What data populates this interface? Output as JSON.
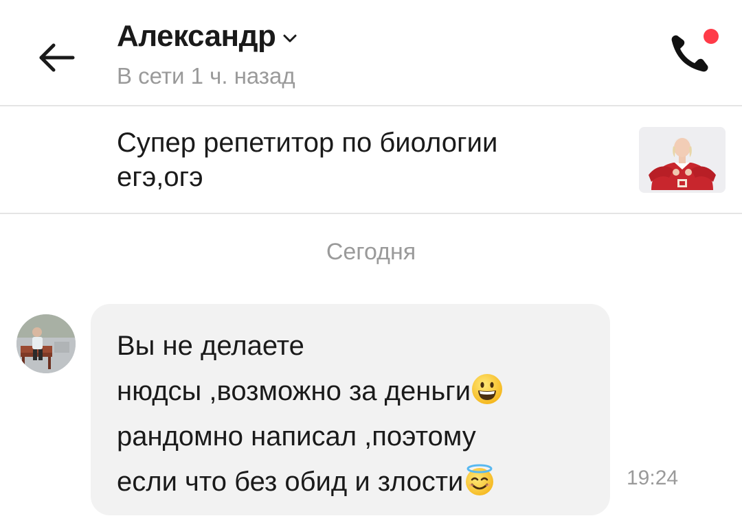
{
  "header": {
    "contact_name": "Александр",
    "status": "В сети 1 ч. назад",
    "icons": {
      "back": "arrow-left-icon",
      "dropdown": "chevron-down-icon",
      "call": "phone-icon"
    },
    "notification_color": "#ff3b48"
  },
  "listing": {
    "title_line1": "Супер репетитор по биологии",
    "title_line2": "егэ,огэ",
    "thumbnail": "listing-photo"
  },
  "chat": {
    "date_separator": "Сегодня",
    "messages": [
      {
        "sender": "Александр",
        "lines": [
          "Вы не делаете",
          "нюдсы ,возможно за деньги",
          "рандомно написал ,поэтому",
          "если что без обид и злости"
        ],
        "emojis": [
          "grinning-face-emoji",
          "smiling-face-with-halo-emoji"
        ],
        "time": "19:24"
      }
    ]
  },
  "colors": {
    "text": "#1a1a1a",
    "muted": "#9a9a9a",
    "bubble": "#f2f2f2",
    "divider": "#e4e4e4"
  }
}
